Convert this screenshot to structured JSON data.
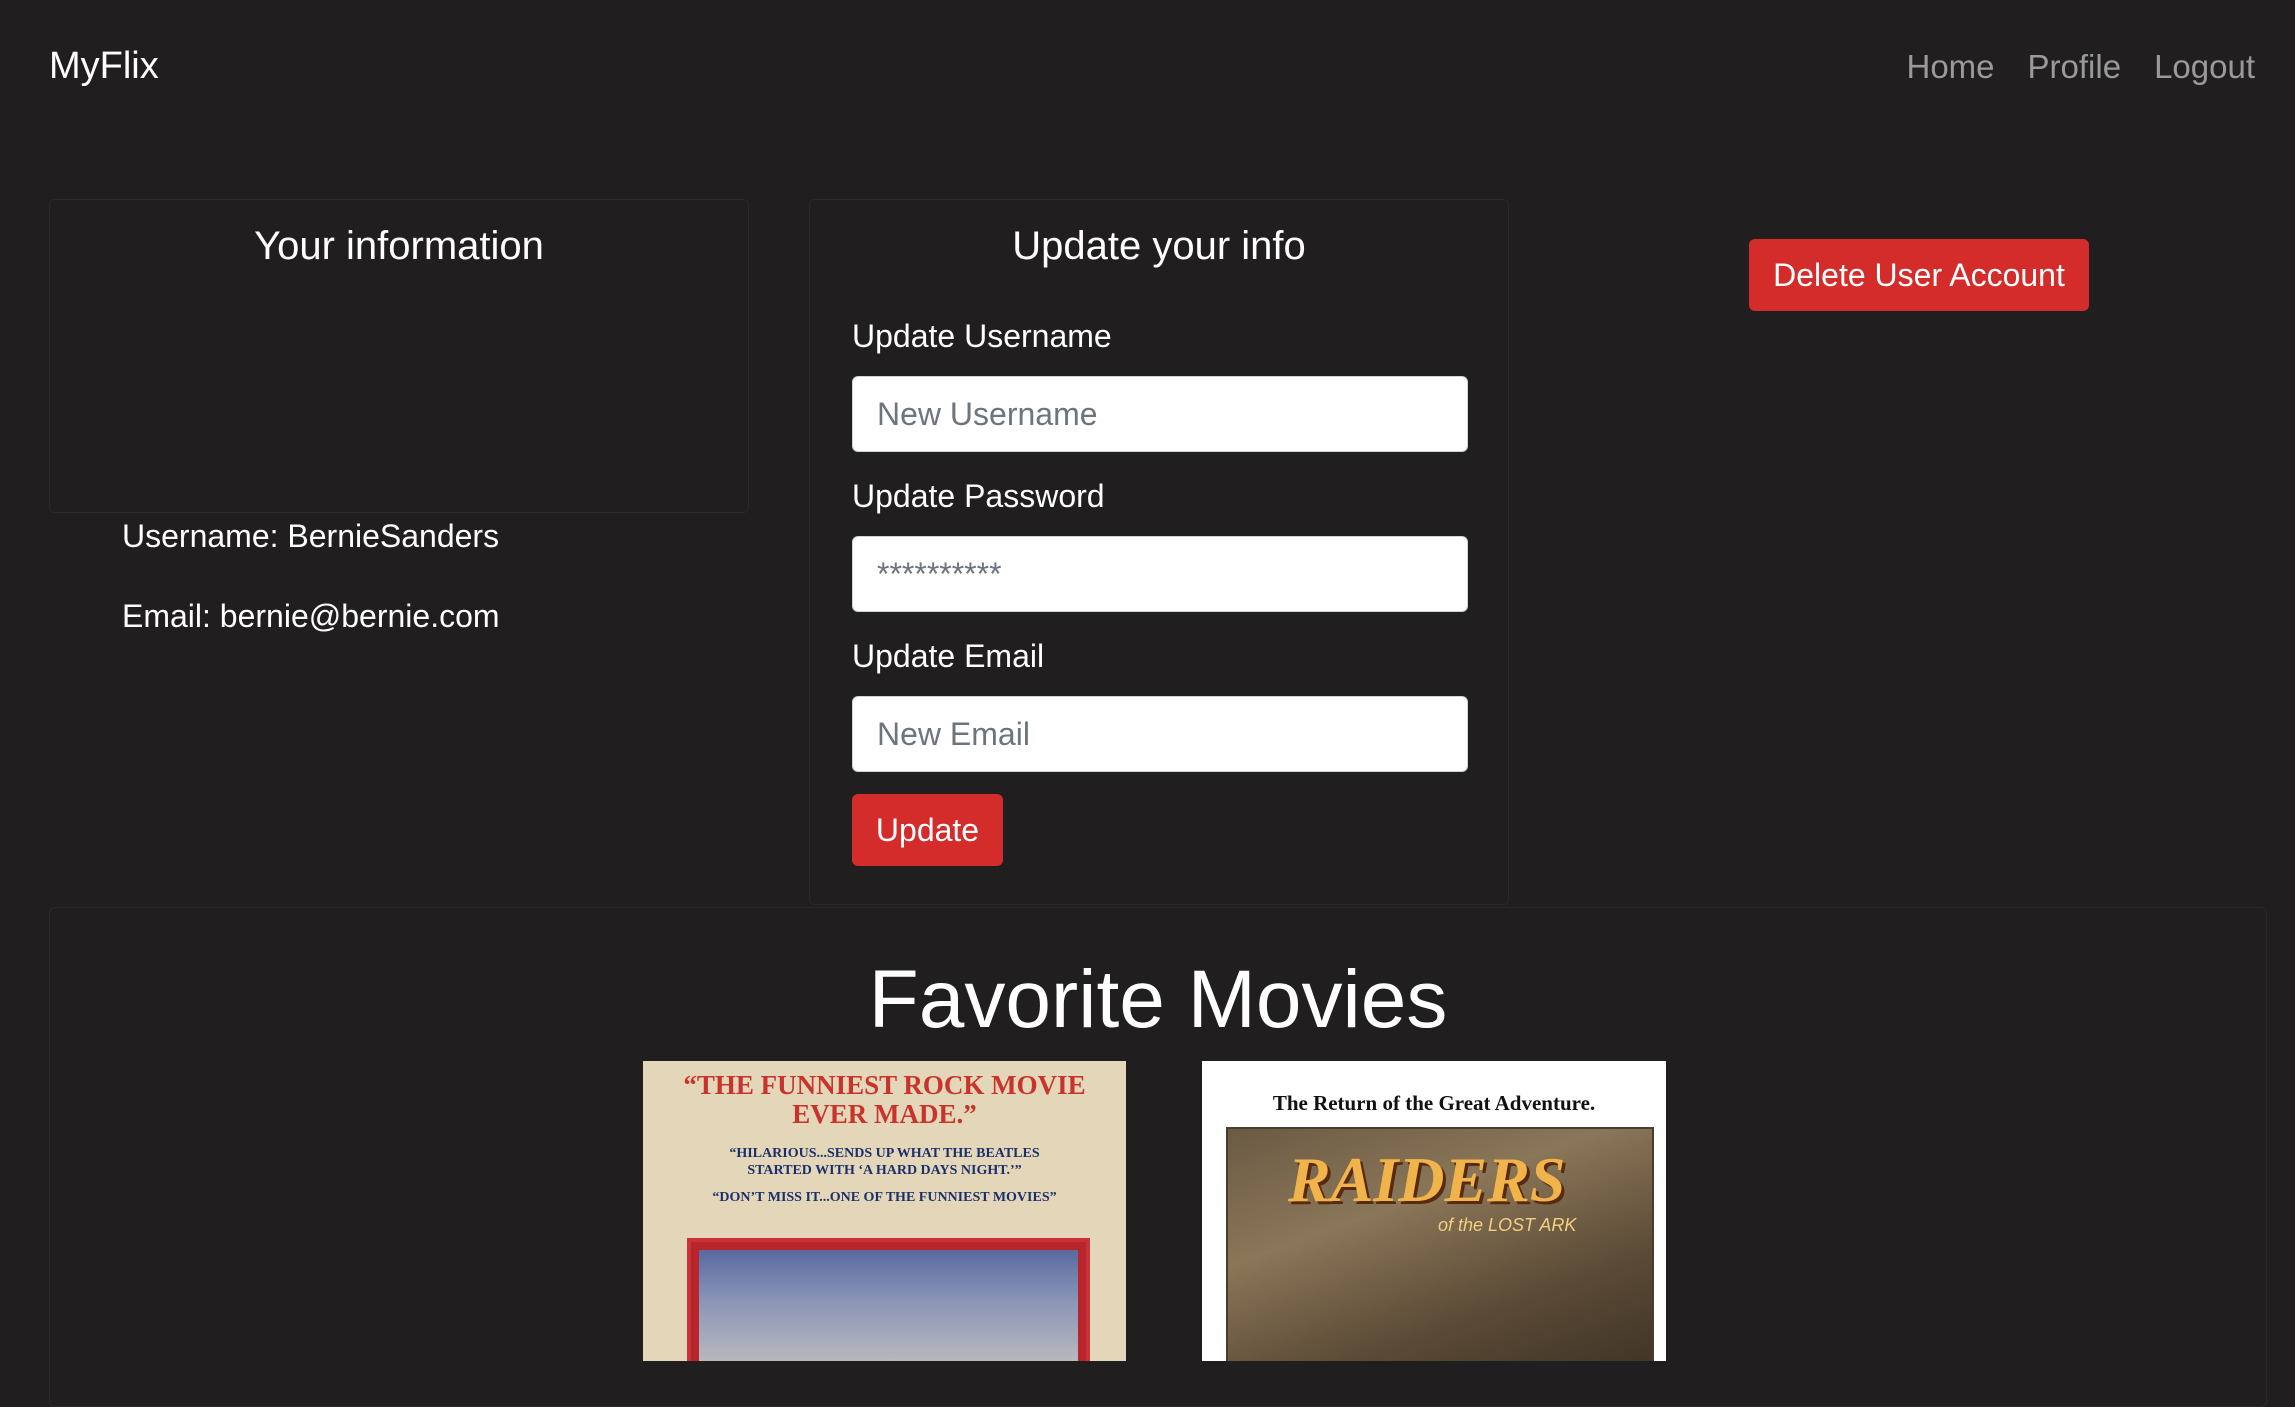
{
  "navbar": {
    "brand": "MyFlix",
    "links": [
      "Home",
      "Profile",
      "Logout"
    ]
  },
  "info_card": {
    "title": "Your information",
    "username_line": "Username: BernieSanders",
    "email_line": "Email: bernie@bernie.com"
  },
  "update_card": {
    "title": "Update your info",
    "username_label": "Update Username",
    "username_placeholder": "New Username",
    "password_label": "Update Password",
    "password_placeholder": "**********",
    "email_label": "Update Email",
    "email_placeholder": "New Email",
    "update_button": "Update"
  },
  "delete_button": "Delete User Account",
  "favorites": {
    "title": "Favorite Movies",
    "posters": [
      {
        "headline": "“THE FUNNIEST ROCK MOVIE EVER MADE.”",
        "quote1": "“HILARIOUS...SENDS UP WHAT THE BEATLES STARTED WITH ‘A HARD DAYS NIGHT.’”",
        "quote2": "“DON’T MISS IT...ONE OF THE FUNNIEST MOVIES”"
      },
      {
        "tagline": "The Return of the Great Adventure.",
        "title_art": "RAIDERS",
        "subtitle_art": "of the LOST ARK"
      }
    ]
  },
  "colors": {
    "background": "#201e1f",
    "accent_red": "#d42b2b",
    "nav_link": "#9a9a9a"
  }
}
